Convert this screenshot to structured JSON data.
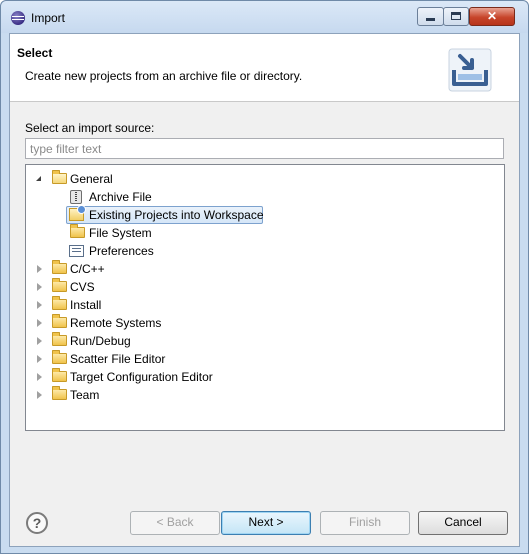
{
  "window": {
    "title": "Import",
    "close_glyph": "✕"
  },
  "header": {
    "title": "Select",
    "description": "Create new projects from an archive file or directory.",
    "banner_icon": "import-banner-icon"
  },
  "source": {
    "label": "Select an import source:",
    "filter_placeholder": "type filter text",
    "filter_value": ""
  },
  "tree": {
    "general": {
      "label": "General",
      "expanded": true,
      "children": [
        {
          "label": "Archive File",
          "icon": "archive-icon"
        },
        {
          "label": "Existing Projects into Workspace",
          "icon": "projects-icon",
          "selected": true
        },
        {
          "label": "File System",
          "icon": "folder-icon"
        },
        {
          "label": "Preferences",
          "icon": "preferences-icon"
        }
      ]
    },
    "categories": [
      {
        "label": "C/C++"
      },
      {
        "label": "CVS"
      },
      {
        "label": "Install"
      },
      {
        "label": "Remote Systems"
      },
      {
        "label": "Run/Debug"
      },
      {
        "label": "Scatter File Editor"
      },
      {
        "label": "Target Configuration Editor"
      },
      {
        "label": "Team"
      }
    ]
  },
  "buttons": {
    "help_glyph": "?",
    "back": "< Back",
    "next": "Next >",
    "finish": "Finish",
    "cancel": "Cancel"
  },
  "colors": {
    "window_frame": "#c9dcf0",
    "selection_border": "#7da2ce",
    "default_button": "#c4e5f6"
  }
}
